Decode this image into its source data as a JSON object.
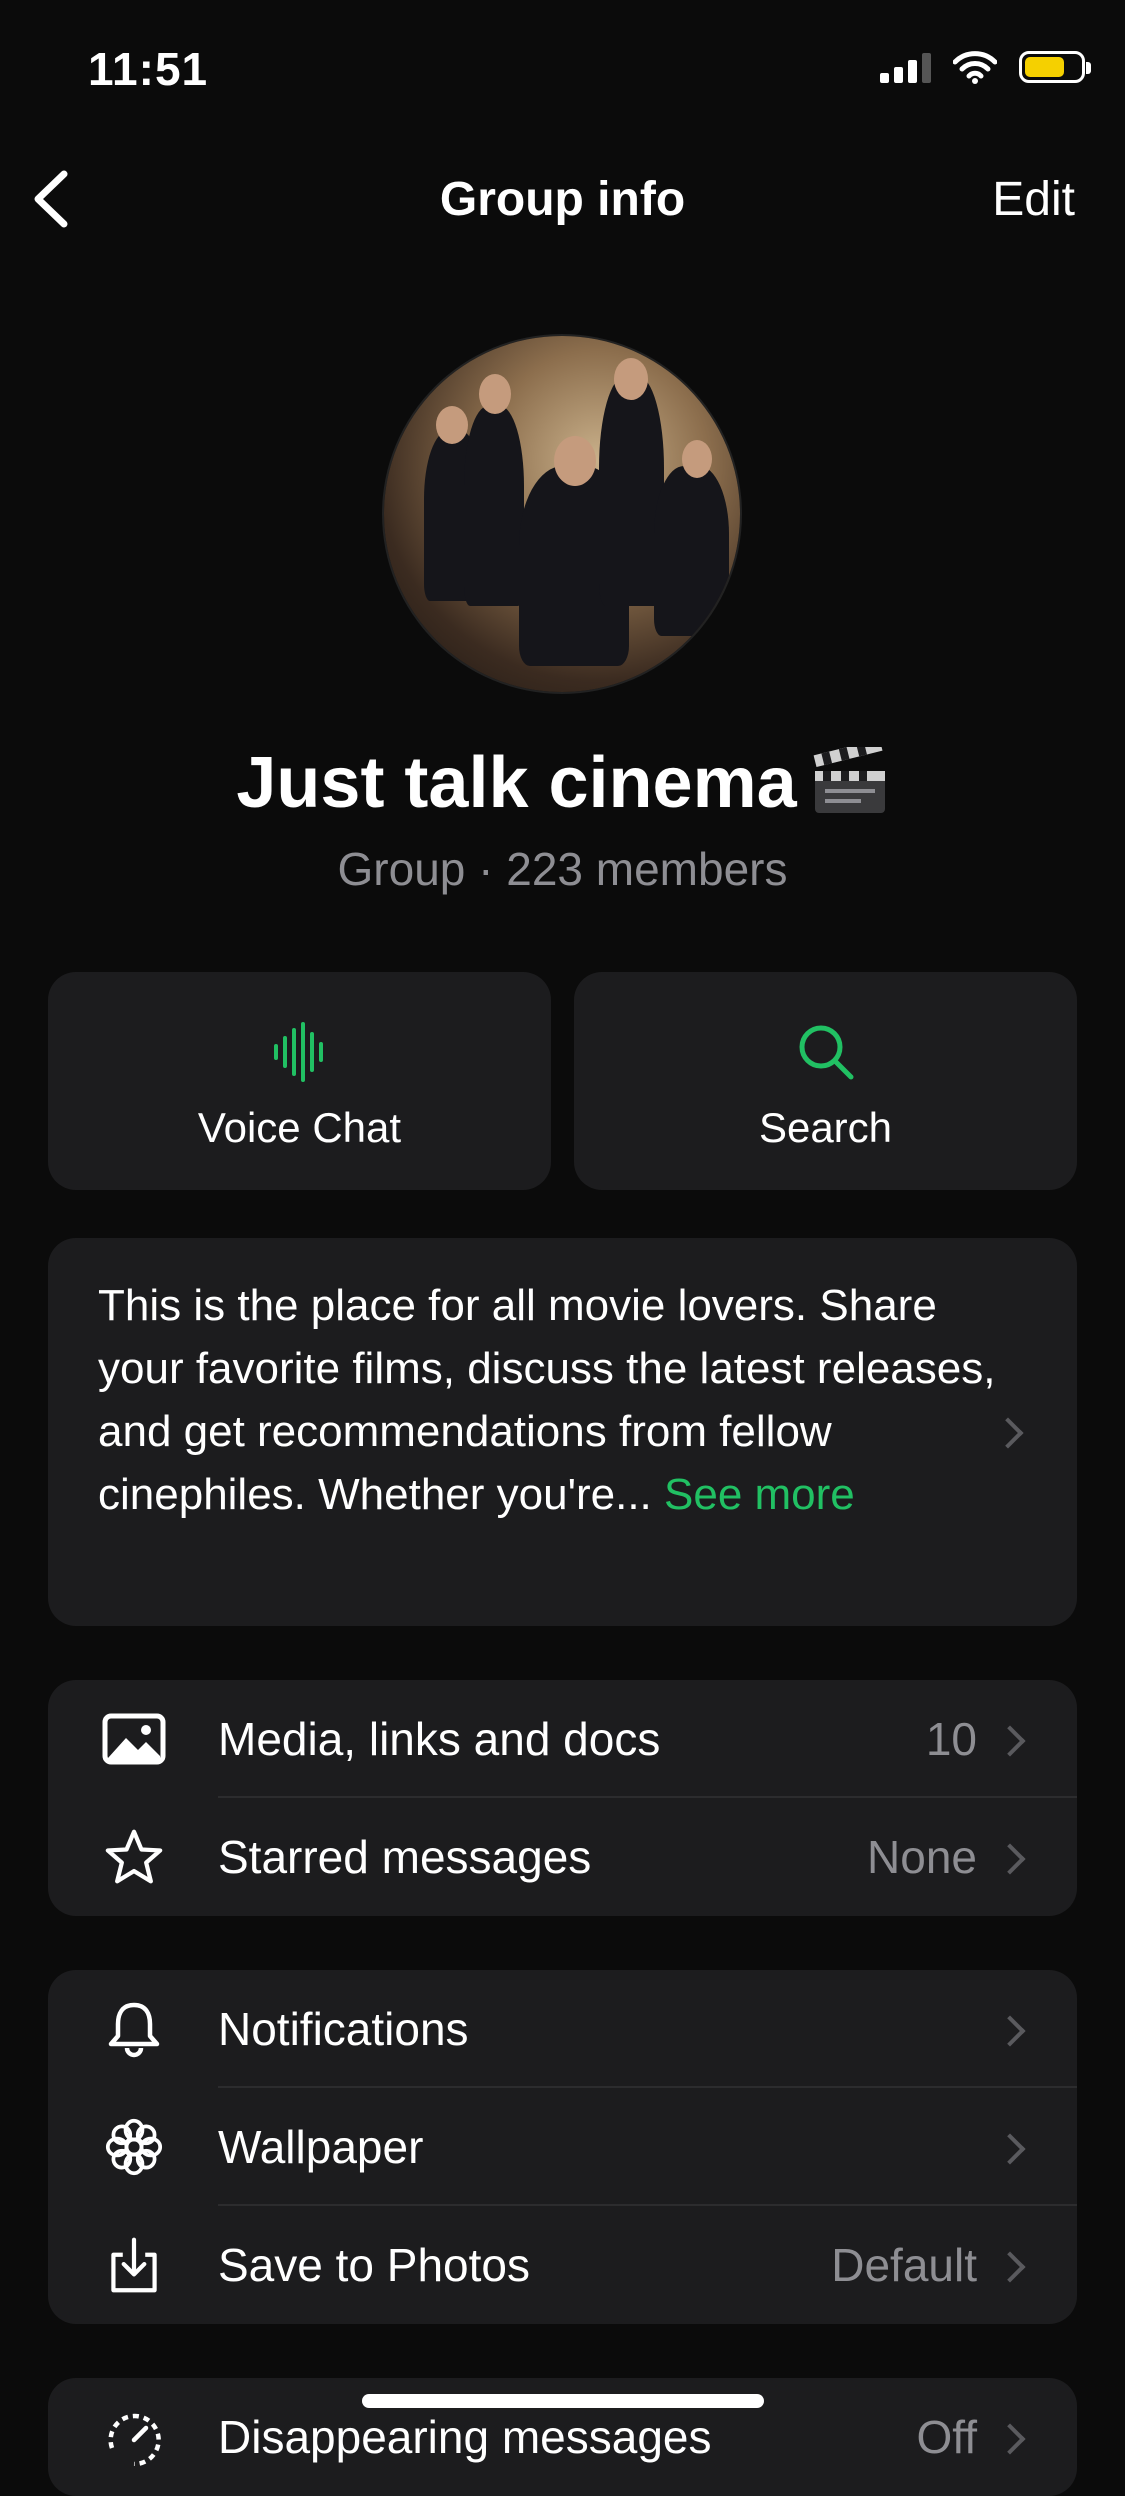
{
  "status_bar": {
    "time": "11:51"
  },
  "nav": {
    "title": "Group info",
    "edit_label": "Edit"
  },
  "group": {
    "name": "Just talk cinema",
    "subtitle": "Group · 223 members"
  },
  "actions": [
    {
      "label": "Voice Chat",
      "icon": "voice-waveform-icon"
    },
    {
      "label": "Search",
      "icon": "search-icon"
    }
  ],
  "description": {
    "text": "This is the place for all movie lovers. Share your favorite films, discuss the latest releases, and get recommendations from fellow cinephiles. Whether you're...",
    "see_more": "See more"
  },
  "list_group_1": [
    {
      "label": "Media, links and docs",
      "value": "10",
      "icon": "image-icon"
    },
    {
      "label": "Starred messages",
      "value": "None",
      "icon": "star-icon"
    }
  ],
  "list_group_2": [
    {
      "label": "Notifications",
      "value": "",
      "icon": "bell-icon"
    },
    {
      "label": "Wallpaper",
      "value": "",
      "icon": "flower-icon"
    },
    {
      "label": "Save to Photos",
      "value": "Default",
      "icon": "download-icon"
    }
  ],
  "list_group_3": [
    {
      "label": "Disappearing messages",
      "value": "Off",
      "icon": "timer-icon"
    }
  ],
  "colors": {
    "accent": "#21c063",
    "background": "#0b0b0b",
    "card": "#1c1c1e",
    "secondary_text": "#8e8e93",
    "battery": "#f5d000"
  }
}
